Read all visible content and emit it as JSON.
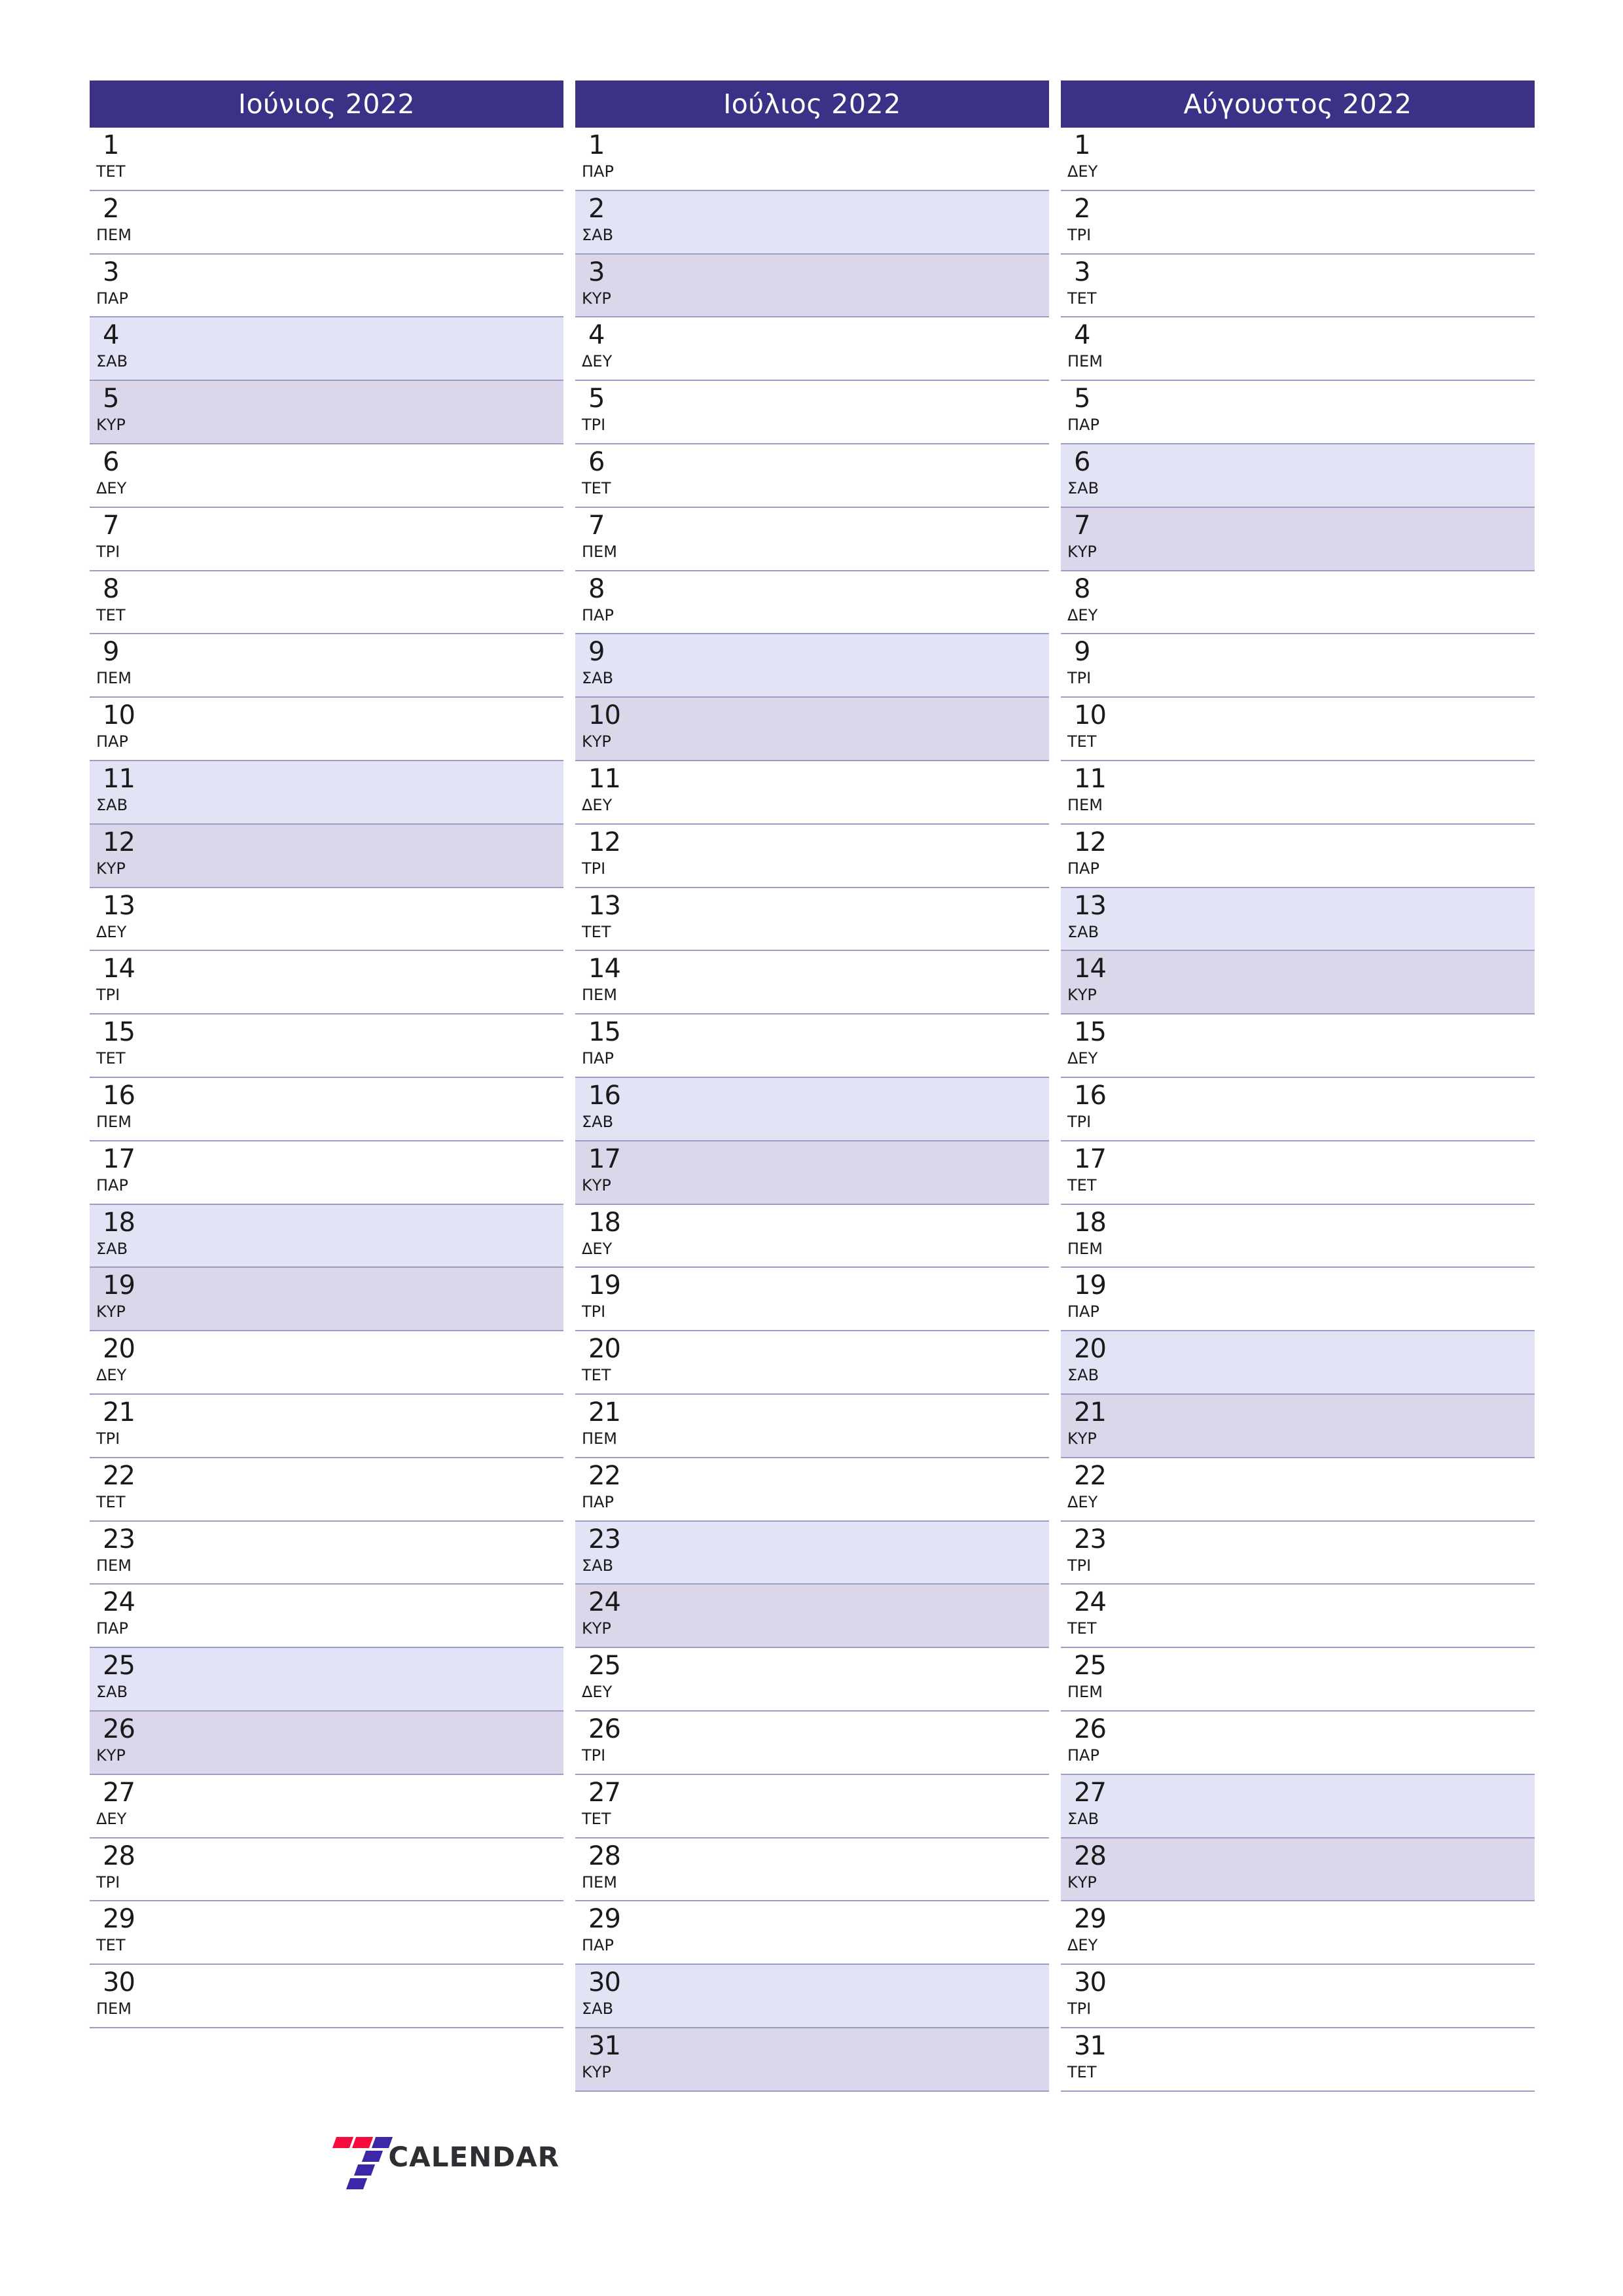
{
  "meta": {
    "year": "2022",
    "colors": {
      "header_bg": "#3B3186",
      "header_text": "#FFFFFF",
      "saturday_bg": "#E3E3F6",
      "sunday_bg": "#DBD6E9",
      "row_border": "#9C9CC8",
      "day_text": "#1A1A1A",
      "logo_red": "#F50B3C",
      "logo_blue": "#3B27A8",
      "logo_text": "#2E2E33"
    }
  },
  "logo": {
    "mark_name": "seven-logo-mark",
    "text": "CALENDAR"
  },
  "months": [
    {
      "title": "Ιούνιος 2022",
      "name": "june",
      "days": [
        {
          "num": "1",
          "wd": "ΤΕΤ",
          "type": "weekday"
        },
        {
          "num": "2",
          "wd": "ΠΕΜ",
          "type": "weekday"
        },
        {
          "num": "3",
          "wd": "ΠΑΡ",
          "type": "weekday"
        },
        {
          "num": "4",
          "wd": "ΣΑΒ",
          "type": "sat"
        },
        {
          "num": "5",
          "wd": "ΚΥΡ",
          "type": "sun"
        },
        {
          "num": "6",
          "wd": "ΔΕΥ",
          "type": "weekday"
        },
        {
          "num": "7",
          "wd": "ΤΡΙ",
          "type": "weekday"
        },
        {
          "num": "8",
          "wd": "ΤΕΤ",
          "type": "weekday"
        },
        {
          "num": "9",
          "wd": "ΠΕΜ",
          "type": "weekday"
        },
        {
          "num": "10",
          "wd": "ΠΑΡ",
          "type": "weekday"
        },
        {
          "num": "11",
          "wd": "ΣΑΒ",
          "type": "sat"
        },
        {
          "num": "12",
          "wd": "ΚΥΡ",
          "type": "sun"
        },
        {
          "num": "13",
          "wd": "ΔΕΥ",
          "type": "weekday"
        },
        {
          "num": "14",
          "wd": "ΤΡΙ",
          "type": "weekday"
        },
        {
          "num": "15",
          "wd": "ΤΕΤ",
          "type": "weekday"
        },
        {
          "num": "16",
          "wd": "ΠΕΜ",
          "type": "weekday"
        },
        {
          "num": "17",
          "wd": "ΠΑΡ",
          "type": "weekday"
        },
        {
          "num": "18",
          "wd": "ΣΑΒ",
          "type": "sat"
        },
        {
          "num": "19",
          "wd": "ΚΥΡ",
          "type": "sun"
        },
        {
          "num": "20",
          "wd": "ΔΕΥ",
          "type": "weekday"
        },
        {
          "num": "21",
          "wd": "ΤΡΙ",
          "type": "weekday"
        },
        {
          "num": "22",
          "wd": "ΤΕΤ",
          "type": "weekday"
        },
        {
          "num": "23",
          "wd": "ΠΕΜ",
          "type": "weekday"
        },
        {
          "num": "24",
          "wd": "ΠΑΡ",
          "type": "weekday"
        },
        {
          "num": "25",
          "wd": "ΣΑΒ",
          "type": "sat"
        },
        {
          "num": "26",
          "wd": "ΚΥΡ",
          "type": "sun"
        },
        {
          "num": "27",
          "wd": "ΔΕΥ",
          "type": "weekday"
        },
        {
          "num": "28",
          "wd": "ΤΡΙ",
          "type": "weekday"
        },
        {
          "num": "29",
          "wd": "ΤΕΤ",
          "type": "weekday"
        },
        {
          "num": "30",
          "wd": "ΠΕΜ",
          "type": "weekday"
        }
      ]
    },
    {
      "title": "Ιούλιος 2022",
      "name": "july",
      "days": [
        {
          "num": "1",
          "wd": "ΠΑΡ",
          "type": "weekday"
        },
        {
          "num": "2",
          "wd": "ΣΑΒ",
          "type": "sat"
        },
        {
          "num": "3",
          "wd": "ΚΥΡ",
          "type": "sun"
        },
        {
          "num": "4",
          "wd": "ΔΕΥ",
          "type": "weekday"
        },
        {
          "num": "5",
          "wd": "ΤΡΙ",
          "type": "weekday"
        },
        {
          "num": "6",
          "wd": "ΤΕΤ",
          "type": "weekday"
        },
        {
          "num": "7",
          "wd": "ΠΕΜ",
          "type": "weekday"
        },
        {
          "num": "8",
          "wd": "ΠΑΡ",
          "type": "weekday"
        },
        {
          "num": "9",
          "wd": "ΣΑΒ",
          "type": "sat"
        },
        {
          "num": "10",
          "wd": "ΚΥΡ",
          "type": "sun"
        },
        {
          "num": "11",
          "wd": "ΔΕΥ",
          "type": "weekday"
        },
        {
          "num": "12",
          "wd": "ΤΡΙ",
          "type": "weekday"
        },
        {
          "num": "13",
          "wd": "ΤΕΤ",
          "type": "weekday"
        },
        {
          "num": "14",
          "wd": "ΠΕΜ",
          "type": "weekday"
        },
        {
          "num": "15",
          "wd": "ΠΑΡ",
          "type": "weekday"
        },
        {
          "num": "16",
          "wd": "ΣΑΒ",
          "type": "sat"
        },
        {
          "num": "17",
          "wd": "ΚΥΡ",
          "type": "sun"
        },
        {
          "num": "18",
          "wd": "ΔΕΥ",
          "type": "weekday"
        },
        {
          "num": "19",
          "wd": "ΤΡΙ",
          "type": "weekday"
        },
        {
          "num": "20",
          "wd": "ΤΕΤ",
          "type": "weekday"
        },
        {
          "num": "21",
          "wd": "ΠΕΜ",
          "type": "weekday"
        },
        {
          "num": "22",
          "wd": "ΠΑΡ",
          "type": "weekday"
        },
        {
          "num": "23",
          "wd": "ΣΑΒ",
          "type": "sat"
        },
        {
          "num": "24",
          "wd": "ΚΥΡ",
          "type": "sun"
        },
        {
          "num": "25",
          "wd": "ΔΕΥ",
          "type": "weekday"
        },
        {
          "num": "26",
          "wd": "ΤΡΙ",
          "type": "weekday"
        },
        {
          "num": "27",
          "wd": "ΤΕΤ",
          "type": "weekday"
        },
        {
          "num": "28",
          "wd": "ΠΕΜ",
          "type": "weekday"
        },
        {
          "num": "29",
          "wd": "ΠΑΡ",
          "type": "weekday"
        },
        {
          "num": "30",
          "wd": "ΣΑΒ",
          "type": "sat"
        },
        {
          "num": "31",
          "wd": "ΚΥΡ",
          "type": "sun"
        }
      ]
    },
    {
      "title": "Αύγουστος 2022",
      "name": "august",
      "days": [
        {
          "num": "1",
          "wd": "ΔΕΥ",
          "type": "weekday"
        },
        {
          "num": "2",
          "wd": "ΤΡΙ",
          "type": "weekday"
        },
        {
          "num": "3",
          "wd": "ΤΕΤ",
          "type": "weekday"
        },
        {
          "num": "4",
          "wd": "ΠΕΜ",
          "type": "weekday"
        },
        {
          "num": "5",
          "wd": "ΠΑΡ",
          "type": "weekday"
        },
        {
          "num": "6",
          "wd": "ΣΑΒ",
          "type": "sat"
        },
        {
          "num": "7",
          "wd": "ΚΥΡ",
          "type": "sun"
        },
        {
          "num": "8",
          "wd": "ΔΕΥ",
          "type": "weekday"
        },
        {
          "num": "9",
          "wd": "ΤΡΙ",
          "type": "weekday"
        },
        {
          "num": "10",
          "wd": "ΤΕΤ",
          "type": "weekday"
        },
        {
          "num": "11",
          "wd": "ΠΕΜ",
          "type": "weekday"
        },
        {
          "num": "12",
          "wd": "ΠΑΡ",
          "type": "weekday"
        },
        {
          "num": "13",
          "wd": "ΣΑΒ",
          "type": "sat"
        },
        {
          "num": "14",
          "wd": "ΚΥΡ",
          "type": "sun"
        },
        {
          "num": "15",
          "wd": "ΔΕΥ",
          "type": "weekday"
        },
        {
          "num": "16",
          "wd": "ΤΡΙ",
          "type": "weekday"
        },
        {
          "num": "17",
          "wd": "ΤΕΤ",
          "type": "weekday"
        },
        {
          "num": "18",
          "wd": "ΠΕΜ",
          "type": "weekday"
        },
        {
          "num": "19",
          "wd": "ΠΑΡ",
          "type": "weekday"
        },
        {
          "num": "20",
          "wd": "ΣΑΒ",
          "type": "sat"
        },
        {
          "num": "21",
          "wd": "ΚΥΡ",
          "type": "sun"
        },
        {
          "num": "22",
          "wd": "ΔΕΥ",
          "type": "weekday"
        },
        {
          "num": "23",
          "wd": "ΤΡΙ",
          "type": "weekday"
        },
        {
          "num": "24",
          "wd": "ΤΕΤ",
          "type": "weekday"
        },
        {
          "num": "25",
          "wd": "ΠΕΜ",
          "type": "weekday"
        },
        {
          "num": "26",
          "wd": "ΠΑΡ",
          "type": "weekday"
        },
        {
          "num": "27",
          "wd": "ΣΑΒ",
          "type": "sat"
        },
        {
          "num": "28",
          "wd": "ΚΥΡ",
          "type": "sun"
        },
        {
          "num": "29",
          "wd": "ΔΕΥ",
          "type": "weekday"
        },
        {
          "num": "30",
          "wd": "ΤΡΙ",
          "type": "weekday"
        },
        {
          "num": "31",
          "wd": "ΤΕΤ",
          "type": "weekday"
        }
      ]
    }
  ]
}
